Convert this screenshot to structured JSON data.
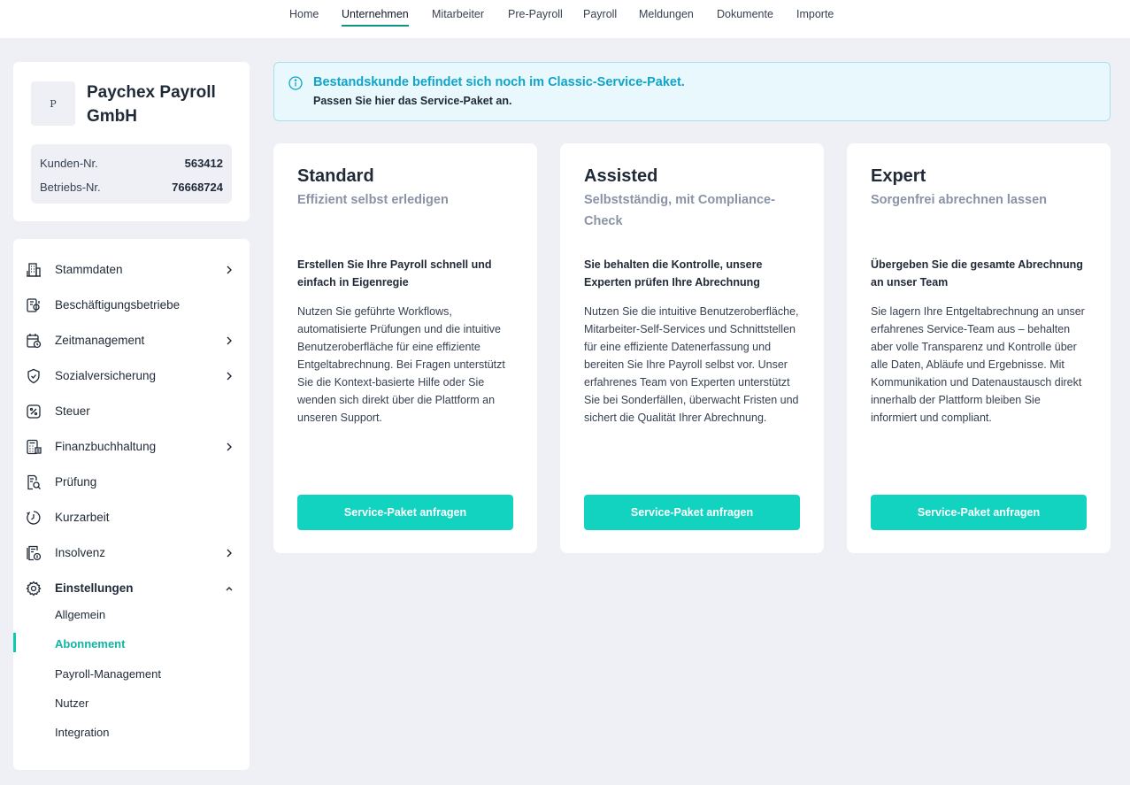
{
  "nav": {
    "items": [
      "Home",
      "Unternehmen",
      "Mitarbeiter",
      "Pre-Payroll",
      "Payroll",
      "Meldungen",
      "Dokumente",
      "Importe"
    ],
    "active": "Unternehmen"
  },
  "company": {
    "avatar_letter": "P",
    "name": "Paychex Payroll GmbH",
    "customer_no_label": "Kunden-Nr.",
    "customer_no": "563412",
    "business_no_label": "Betriebs-Nr.",
    "business_no": "76668724"
  },
  "sidebar": {
    "items": [
      {
        "label": "Stammdaten",
        "icon": "building-icon"
      },
      {
        "label": "Beschäftigungsbetriebe",
        "icon": "company-settings-icon"
      },
      {
        "label": "Zeitmanagement",
        "icon": "calendar-clock-icon"
      },
      {
        "label": "Sozialversicherung",
        "icon": "shield-icon"
      },
      {
        "label": "Steuer",
        "icon": "tax-icon"
      },
      {
        "label": "Finanzbuchhaltung",
        "icon": "calculator-icon"
      },
      {
        "label": "Prüfung",
        "icon": "document-search-icon"
      },
      {
        "label": "Kurzarbeit",
        "icon": "clock-icon"
      },
      {
        "label": "Insolvenz",
        "icon": "document-money-icon"
      },
      {
        "label": "Einstellungen",
        "icon": "gear-icon"
      }
    ],
    "sub_items": [
      "Allgemein",
      "Abonnement",
      "Payroll-Management",
      "Nutzer",
      "Integration"
    ],
    "active_sub": "Abonnement"
  },
  "banner": {
    "title": "Bestandskunde befindet sich noch im Classic-Service-Paket.",
    "text": "Passen Sie hier das Service-Paket an."
  },
  "plans": [
    {
      "name": "Standard",
      "tagline": "Effizient selbst erledigen",
      "headline": "Erstellen Sie Ihre Payroll schnell und einfach in Eigenregie",
      "body": "Nutzen Sie geführte Workflows, automatisierte Prüfungen und die intuitive Benutzeroberfläche für eine effiziente Entgeltabrechnung. Bei Fragen unterstützt Sie die Kontext-basierte Hilfe oder Sie wenden sich direkt über die Plattform an unseren Support.",
      "button": "Service-Paket anfragen"
    },
    {
      "name": "Assisted",
      "tagline": "Selbstständig, mit Compliance-Check",
      "headline": "Sie behalten die Kontrolle, unsere Experten prüfen Ihre Abrechnung",
      "body": "Nutzen Sie die intuitive Benutzeroberfläche, Mitarbeiter-Self-Services und Schnittstellen für eine effiziente Datenerfassung und bereiten Sie Ihre Payroll selbst vor. Unser erfahrenes Team von Experten unterstützt Sie bei Sonderfällen, überwacht Fristen und sichert die Qualität Ihrer Abrechnung.",
      "button": "Service-Paket anfragen"
    },
    {
      "name": "Expert",
      "tagline": "Sorgenfrei abrechnen lassen",
      "headline": "Übergeben Sie die gesamte Abrechnung an unser Team",
      "body": "Sie lagern Ihre Entgeltabrechnung an unser erfahrenes Service-Team aus – behalten aber volle Transparenz und Kontrolle über alle Daten, Abläufe und Ergebnisse. Mit Kommunikation und Datenaustausch direkt innerhalb der Plattform bleiben Sie informiert und compliant.",
      "button": "Service-Paket anfragen"
    }
  ],
  "colors": {
    "accent": "#12d3bf",
    "accent_text": "#0fb5a3",
    "info": "#0ea5c9",
    "page_bg": "#eef0f5"
  }
}
